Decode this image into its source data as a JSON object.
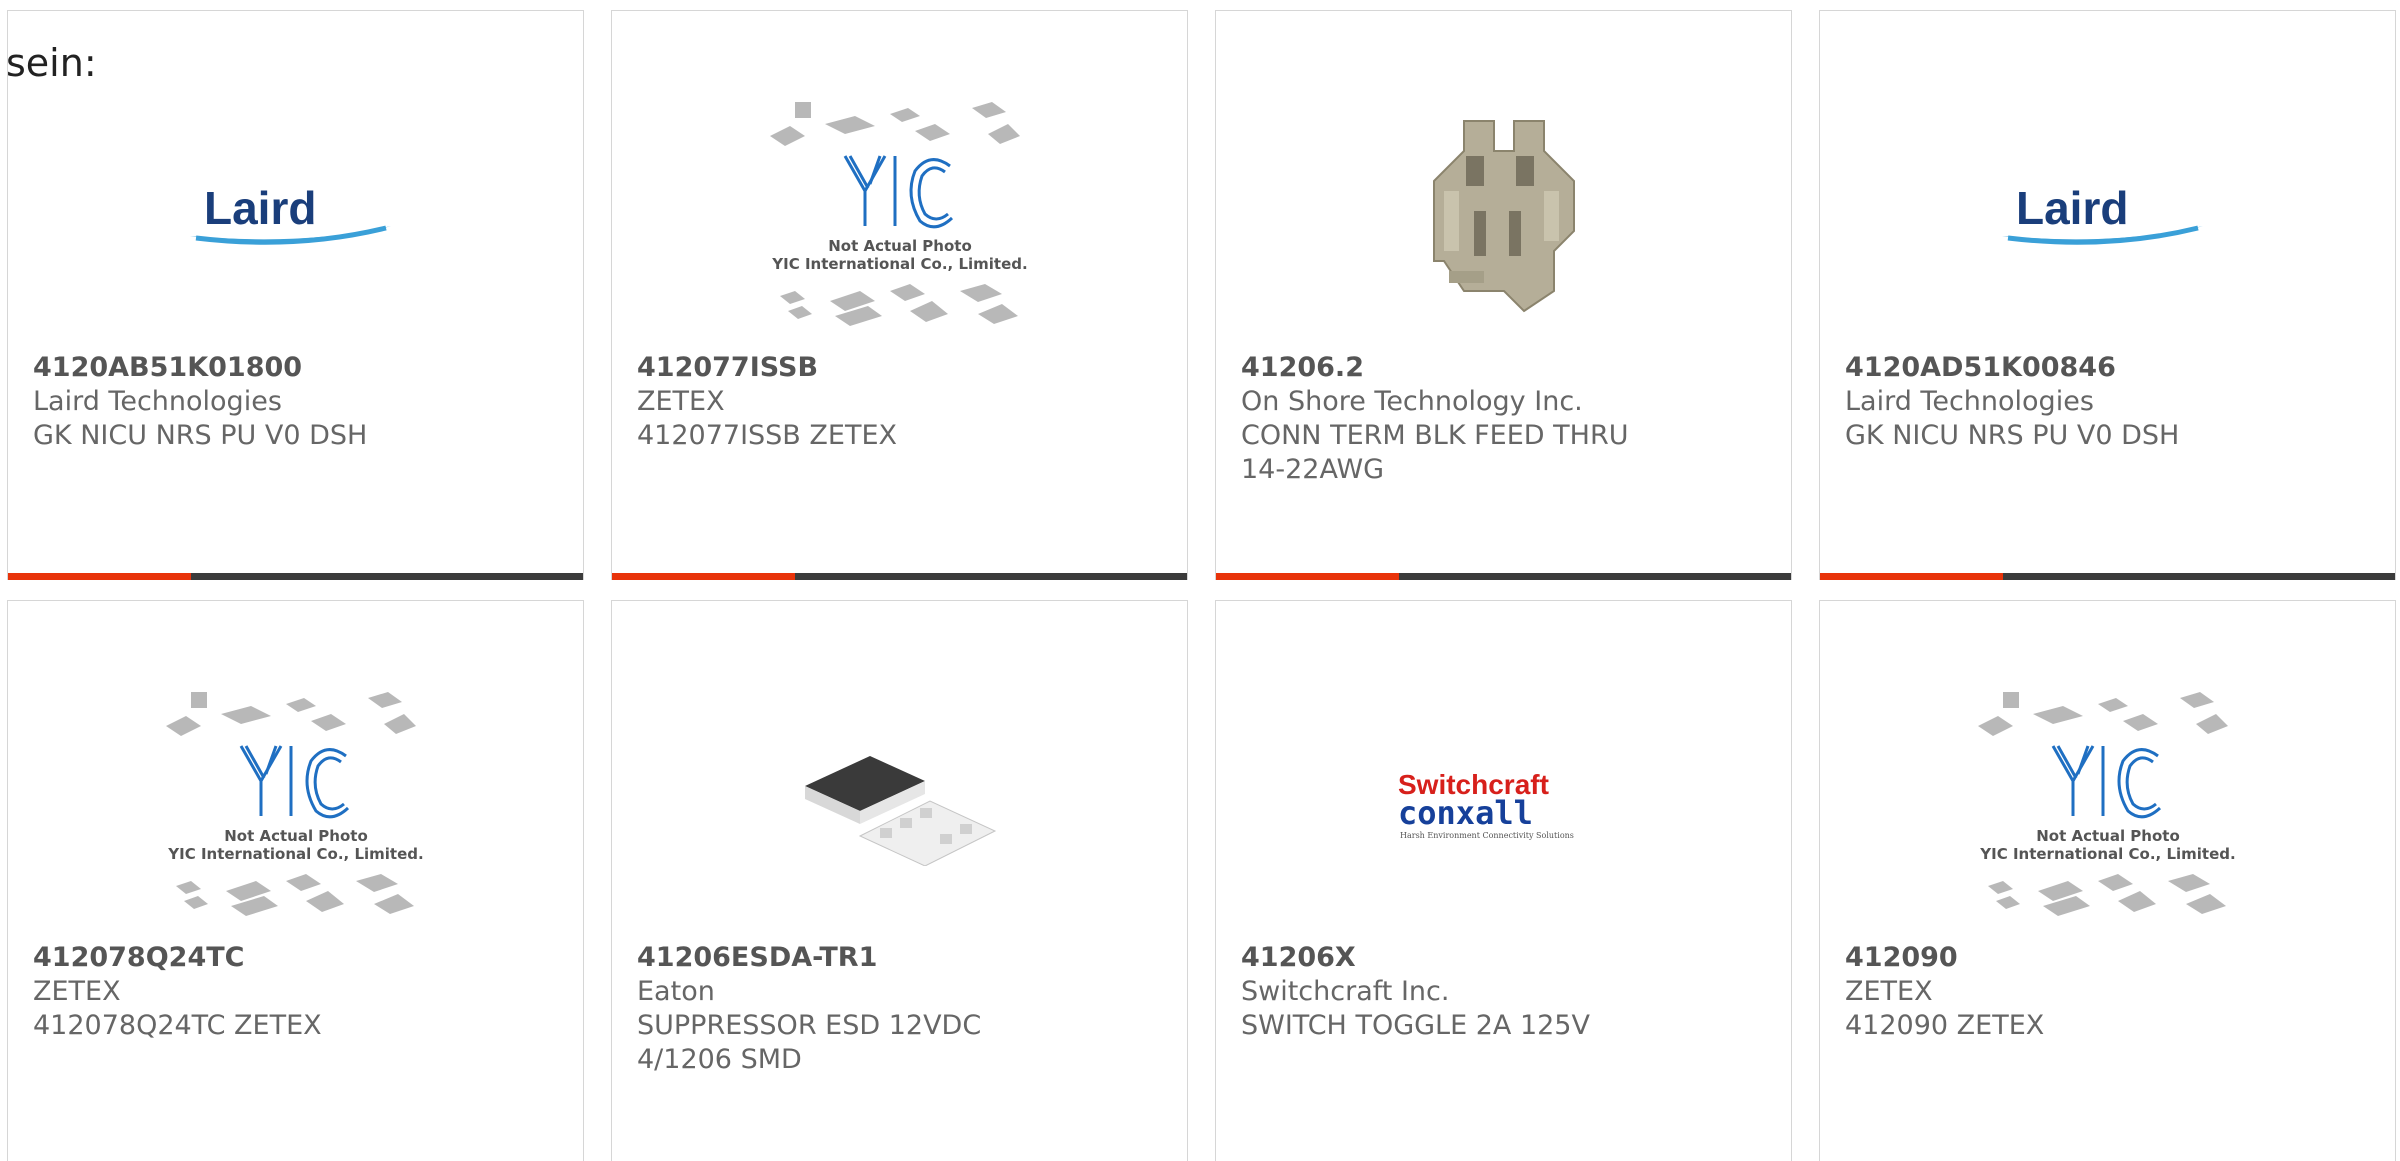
{
  "lead_text": "sein:",
  "colors": {
    "accent": "#e8330a",
    "bar": "#3b3b3b",
    "border": "#d6d6d6",
    "laird_text": "#1a3e7b",
    "laird_swoosh": "#3aa0d8",
    "yic_blue": "#1f6fc2",
    "switchcraft_red": "#d7201b",
    "conxall_blue": "#16409a"
  },
  "placeholder": {
    "line1": "Not Actual Photo",
    "line2": "YIC International Co., Limited."
  },
  "logos": {
    "laird": "Laird",
    "yic": "YIC",
    "switchcraft": "Switchcraft",
    "conxall": "conxall",
    "tagline": "Harsh Environment Connectivity Solutions"
  },
  "products": [
    {
      "part": "4120AB51K01800",
      "manufacturer": "Laird Technologies",
      "description": "GK NICU NRS PU V0 DSH",
      "image": "laird-logo"
    },
    {
      "part": "412077ISSB",
      "manufacturer": "ZETEX",
      "description": "412077ISSB ZETEX",
      "image": "yic-placeholder"
    },
    {
      "part": "41206.2",
      "manufacturer": "On Shore Technology Inc.",
      "description": "CONN TERM BLK FEED THRU 14-22AWG",
      "image": "terminal-block-photo"
    },
    {
      "part": "4120AD51K00846",
      "manufacturer": "Laird Technologies",
      "description": "GK NICU NRS PU V0 DSH",
      "image": "laird-logo"
    },
    {
      "part": "412078Q24TC",
      "manufacturer": "ZETEX",
      "description": "412078Q24TC ZETEX",
      "image": "yic-placeholder"
    },
    {
      "part": "41206ESDA-TR1",
      "manufacturer": "Eaton",
      "description": "SUPPRESSOR ESD 12VDC 4/1206 SMD",
      "image": "esd-array-photo"
    },
    {
      "part": "41206X",
      "manufacturer": "Switchcraft Inc.",
      "description": "SWITCH TOGGLE 2A 125V",
      "image": "switchcraft-logo"
    },
    {
      "part": "412090",
      "manufacturer": "ZETEX",
      "description": "412090 ZETEX",
      "image": "yic-placeholder"
    }
  ]
}
